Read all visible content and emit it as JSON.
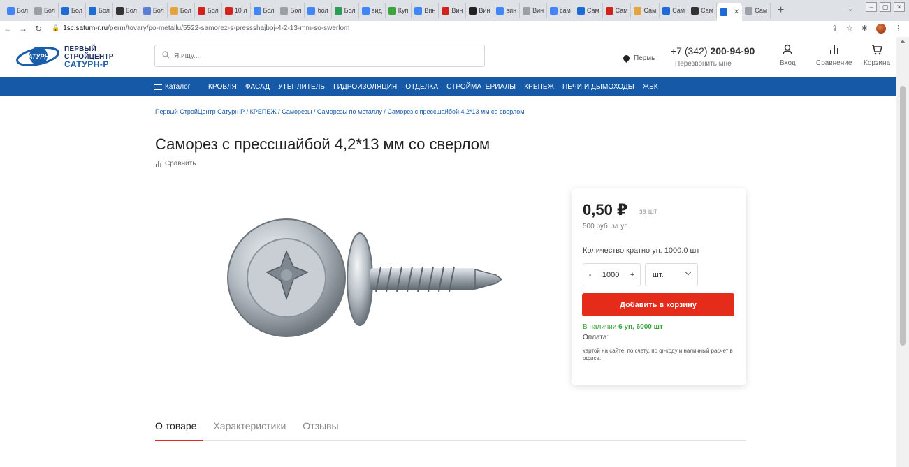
{
  "browser": {
    "tabs": [
      {
        "label": "Бол",
        "color": "#4285f4"
      },
      {
        "label": "Бол",
        "color": "#9aa0a6"
      },
      {
        "label": "Бол",
        "color": "#1e6bd6"
      },
      {
        "label": "Бол",
        "color": "#1e6bd6"
      },
      {
        "label": "Бол",
        "color": "#333333"
      },
      {
        "label": "Бол",
        "color": "#5b7fd6"
      },
      {
        "label": "Бол",
        "color": "#e8a33c"
      },
      {
        "label": "Бол",
        "color": "#d2231e"
      },
      {
        "label": "10 л",
        "color": "#d2231e"
      },
      {
        "label": "Бол",
        "color": "#4285f4"
      },
      {
        "label": "Бол",
        "color": "#9aa0a6"
      },
      {
        "label": "бол",
        "color": "#4285f4"
      },
      {
        "label": "Бол",
        "color": "#2a9d57"
      },
      {
        "label": "вид",
        "color": "#4285f4"
      },
      {
        "label": "Куп",
        "color": "#3aa63a"
      },
      {
        "label": "Вин",
        "color": "#4285f4"
      },
      {
        "label": "Вин",
        "color": "#d2231e"
      },
      {
        "label": "Вин",
        "color": "#222222"
      },
      {
        "label": "вин",
        "color": "#4285f4"
      },
      {
        "label": "Вин",
        "color": "#9aa0a6"
      },
      {
        "label": "сам",
        "color": "#4285f4"
      },
      {
        "label": "Сам",
        "color": "#1e6bd6"
      },
      {
        "label": "Сам",
        "color": "#d2231e"
      },
      {
        "label": "Сам",
        "color": "#e8a33c"
      },
      {
        "label": "Сам",
        "color": "#1e6bd6"
      },
      {
        "label": "Сам",
        "color": "#333333"
      }
    ],
    "active_tab_color": "#1e6bd6",
    "last_tab_label": "Сам",
    "new_tab": "+",
    "url_host": "1sc.saturn-r.ru",
    "url_path": "/perm/tovary/po-metallu/5522-samorez-s-pressshajboj-4-2-13-mm-so-swerlom"
  },
  "header": {
    "logo_circle_text": "АТУРН",
    "logo_line1": "ПЕРВЫЙ",
    "logo_line2": "СТРОЙЦЕНТР",
    "logo_line3": "САТУРН-Р",
    "search_placeholder": "Я ищу...",
    "city": "Пермь",
    "phone_prefix": "+7 (342) ",
    "phone_number": "200-94-90",
    "callback": "Перезвонить мне",
    "login_label": "Вход",
    "compare_label": "Сравнение",
    "cart_label": "Корзина"
  },
  "nav": {
    "catalog_label": "Каталог",
    "items": [
      "Кровля",
      "Фасад",
      "Утеплитель",
      "Гидроизоляция",
      "Отделка",
      "Стройматериалы",
      "Крепеж",
      "Печи и дымоходы",
      "ЖБК"
    ]
  },
  "page": {
    "breadcrumb": "Первый СтройЦентр Сатурн-Р / КРЕПЕЖ / Саморезы / Саморезы по металлу / Саморез с прессшайбой 4,2*13 мм со сверлом",
    "title": "Саморез с прессшайбой 4,2*13 мм со сверлом",
    "compare_link": "Сравнить"
  },
  "buy": {
    "price": "0,50 ₽",
    "price_unit": "за шт",
    "pack_price": "500 руб. за уп",
    "qty_label": "Количество кратно уп. 1000.0 шт",
    "qty_minus": "-",
    "qty_value": "1000",
    "qty_plus": "+",
    "unit": "шт.",
    "add_to_cart": "Добавить в корзину",
    "stock_label": "В наличии ",
    "stock_value": "6 уп, 6000 шт",
    "payment_label": "Оплата:",
    "payment_text": "картой на сайте, по счету, по qr-коду и наличный расчет в офисе."
  },
  "tabs": [
    "О товаре",
    "Характеристики",
    "Отзывы"
  ],
  "colors": {
    "brand_blue": "#1559a7",
    "accent_red": "#e52b1a",
    "stock_green": "#3aa63a"
  }
}
